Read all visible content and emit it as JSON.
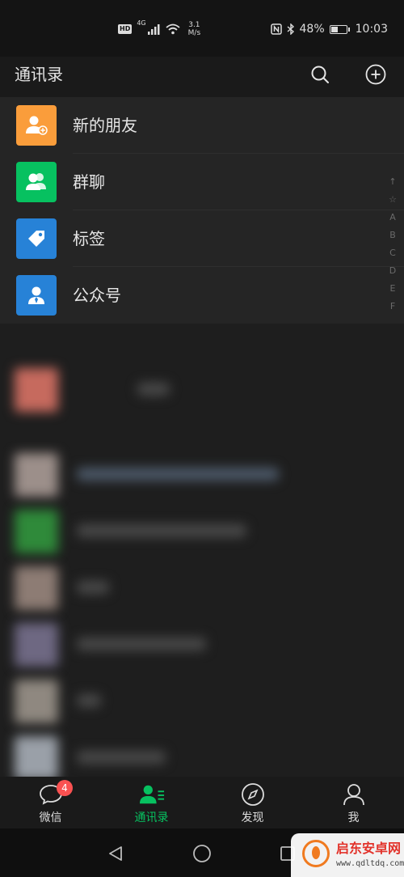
{
  "status_bar": {
    "hd": "HD",
    "network": "4G",
    "speed_value": "3.1",
    "speed_unit": "M/s",
    "battery": "48%",
    "battery_level": 0.48,
    "time": "10:03"
  },
  "header": {
    "title": "通讯录",
    "search_icon": "search-icon",
    "add_icon": "plus-circle-icon"
  },
  "menu": {
    "items": [
      {
        "label": "新的朋友",
        "icon": "add-friend-icon",
        "color": "#fa9d3b"
      },
      {
        "label": "群聊",
        "icon": "group-chat-icon",
        "color": "#07c160"
      },
      {
        "label": "标签",
        "icon": "tag-icon",
        "color": "#2782d7"
      },
      {
        "label": "公众号",
        "icon": "official-account-icon",
        "color": "#2782d7"
      }
    ]
  },
  "index_bar": [
    "↑",
    "☆",
    "A",
    "B",
    "C",
    "D",
    "E",
    "F"
  ],
  "tab_bar": {
    "tabs": [
      {
        "label": "微信",
        "icon": "chat-bubble-icon",
        "badge": "4",
        "active": false
      },
      {
        "label": "通讯录",
        "icon": "contacts-icon",
        "active": true
      },
      {
        "label": "发现",
        "icon": "compass-icon",
        "active": false
      },
      {
        "label": "我",
        "icon": "person-icon",
        "active": false
      }
    ],
    "active_color": "#07c160"
  },
  "watermark": {
    "name": "启东安卓网",
    "url": "www.qdltdq.com"
  }
}
